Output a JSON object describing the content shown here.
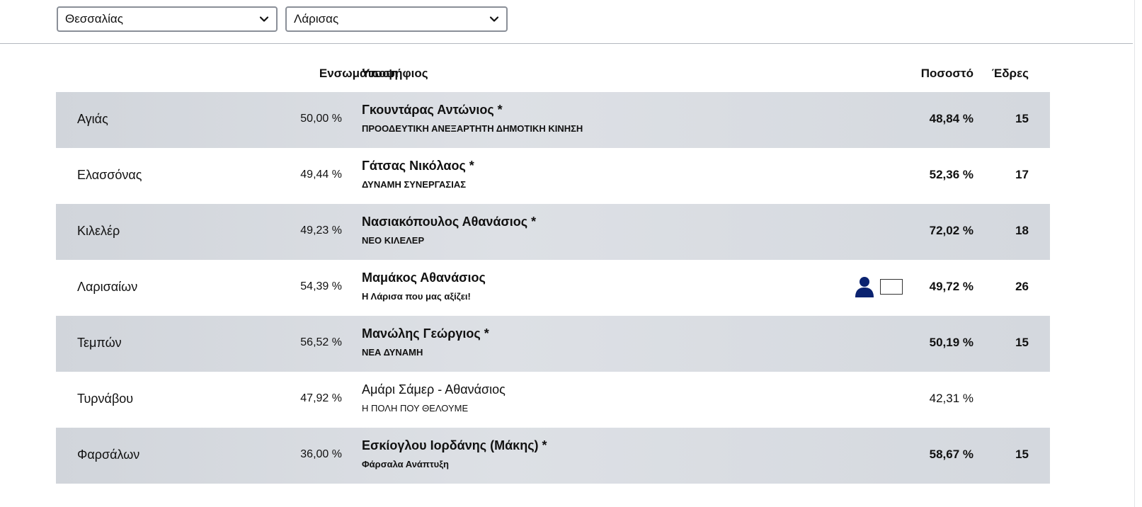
{
  "filters": {
    "region": "Θεσσαλίας",
    "prefecture": "Λάρισας"
  },
  "table": {
    "headers": {
      "incorporation": "Ενσωμάτωση",
      "candidate": "Υποψήφιος",
      "percentage": "Ποσοστό",
      "seats": "Έδρες"
    },
    "rows": [
      {
        "municipality": "Αγιάς",
        "incorporation": "50,00 %",
        "candidate": "Γκουντάρας Αντώνιος *",
        "party": "ΠΡΟΟΔΕΥΤΙΚΗ ΑΝΕΞΑΡΤΗΤΗ ΔΗΜΟΤΙΚΗ ΚΙΝΗΣΗ",
        "percentage": "48,84 %",
        "seats": "15"
      },
      {
        "municipality": "Ελασσόνας",
        "incorporation": "49,44 %",
        "candidate": "Γάτσας Νικόλαος *",
        "party": "ΔΥΝΑΜΗ ΣΥΝΕΡΓΑΣΙΑΣ",
        "percentage": "52,36 %",
        "seats": "17"
      },
      {
        "municipality": "Κιλελέρ",
        "incorporation": "49,23 %",
        "candidate": "Νασιακόπουλος Αθανάσιος *",
        "party": "ΝΕΟ ΚΙΛΕΛΕΡ",
        "percentage": "72,02 %",
        "seats": "18"
      },
      {
        "municipality": "Λαρισαίων",
        "incorporation": "54,39 %",
        "candidate": "Μαμάκος Αθανάσιος",
        "party": "Η Λάρισα που μας αξίζει!",
        "percentage": "49,72 %",
        "seats": "26"
      },
      {
        "municipality": "Τεμπών",
        "incorporation": "56,52 %",
        "candidate": "Μανώλης Γεώργιος *",
        "party": "ΝΕΑ ΔΥΝΑΜΗ",
        "percentage": "50,19 %",
        "seats": "15"
      },
      {
        "municipality": "Τυρνάβου",
        "incorporation": "47,92 %",
        "candidate": "Αμάρι Σάμερ - Αθανάσιος",
        "party": "Η ΠΟΛΗ ΠΟΥ ΘΕΛΟΥΜΕ",
        "percentage": "42,31 %",
        "seats": ""
      },
      {
        "municipality": "Φαρσάλων",
        "incorporation": "36,00 %",
        "candidate": "Εσκίογλου Ιορδάνης (Μάκης) *",
        "party": "Φάρσαλα Ανάπτυξη",
        "percentage": "58,67 %",
        "seats": "15"
      }
    ]
  },
  "icons": {
    "person": "person-icon",
    "box": "checkbox-icon",
    "chevron": "chevron-down-icon"
  },
  "colors": {
    "person_icon": "#0b2370",
    "shaded_row": "#d6d9df"
  }
}
